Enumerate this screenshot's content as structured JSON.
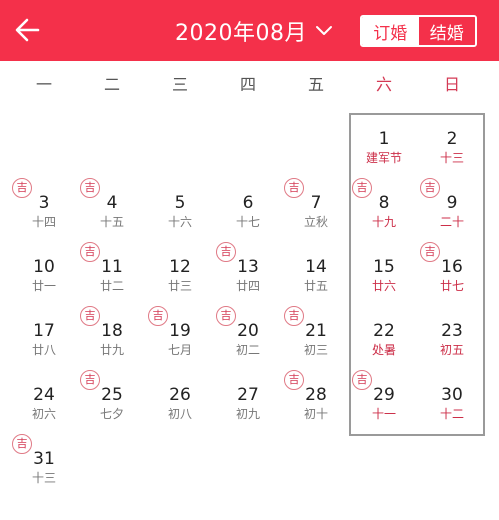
{
  "header": {
    "month": "2020年08月",
    "tabs": [
      {
        "label": "订婚",
        "active": true
      },
      {
        "label": "结婚",
        "active": false
      }
    ]
  },
  "weekdays": [
    "一",
    "二",
    "三",
    "四",
    "五",
    "六",
    "日"
  ],
  "badge_label": "吉",
  "colors": {
    "accent": "#f4304a",
    "weekend_text": "#d43a55",
    "badge": "#d43a55"
  },
  "weeks": [
    [
      null,
      null,
      null,
      null,
      null,
      {
        "day": "1",
        "lunar": "建军节",
        "auspicious": false
      },
      {
        "day": "2",
        "lunar": "十三",
        "auspicious": false
      }
    ],
    [
      {
        "day": "3",
        "lunar": "十四",
        "auspicious": true
      },
      {
        "day": "4",
        "lunar": "十五",
        "auspicious": true
      },
      {
        "day": "5",
        "lunar": "十六",
        "auspicious": false
      },
      {
        "day": "6",
        "lunar": "十七",
        "auspicious": false
      },
      {
        "day": "7",
        "lunar": "立秋",
        "auspicious": true
      },
      {
        "day": "8",
        "lunar": "十九",
        "auspicious": true
      },
      {
        "day": "9",
        "lunar": "二十",
        "auspicious": true
      }
    ],
    [
      {
        "day": "10",
        "lunar": "廿一",
        "auspicious": false
      },
      {
        "day": "11",
        "lunar": "廿二",
        "auspicious": true
      },
      {
        "day": "12",
        "lunar": "廿三",
        "auspicious": false
      },
      {
        "day": "13",
        "lunar": "廿四",
        "auspicious": true
      },
      {
        "day": "14",
        "lunar": "廿五",
        "auspicious": false
      },
      {
        "day": "15",
        "lunar": "廿六",
        "auspicious": false
      },
      {
        "day": "16",
        "lunar": "廿七",
        "auspicious": true
      }
    ],
    [
      {
        "day": "17",
        "lunar": "廿八",
        "auspicious": false
      },
      {
        "day": "18",
        "lunar": "廿九",
        "auspicious": true
      },
      {
        "day": "19",
        "lunar": "七月",
        "auspicious": true
      },
      {
        "day": "20",
        "lunar": "初二",
        "auspicious": true
      },
      {
        "day": "21",
        "lunar": "初三",
        "auspicious": true
      },
      {
        "day": "22",
        "lunar": "处暑",
        "auspicious": false
      },
      {
        "day": "23",
        "lunar": "初五",
        "auspicious": false
      }
    ],
    [
      {
        "day": "24",
        "lunar": "初六",
        "auspicious": false
      },
      {
        "day": "25",
        "lunar": "七夕",
        "auspicious": true
      },
      {
        "day": "26",
        "lunar": "初八",
        "auspicious": false
      },
      {
        "day": "27",
        "lunar": "初九",
        "auspicious": false
      },
      {
        "day": "28",
        "lunar": "初十",
        "auspicious": true
      },
      {
        "day": "29",
        "lunar": "十一",
        "auspicious": true
      },
      {
        "day": "30",
        "lunar": "十二",
        "auspicious": false
      }
    ],
    [
      {
        "day": "31",
        "lunar": "十三",
        "auspicious": true
      },
      null,
      null,
      null,
      null,
      null,
      null
    ]
  ]
}
